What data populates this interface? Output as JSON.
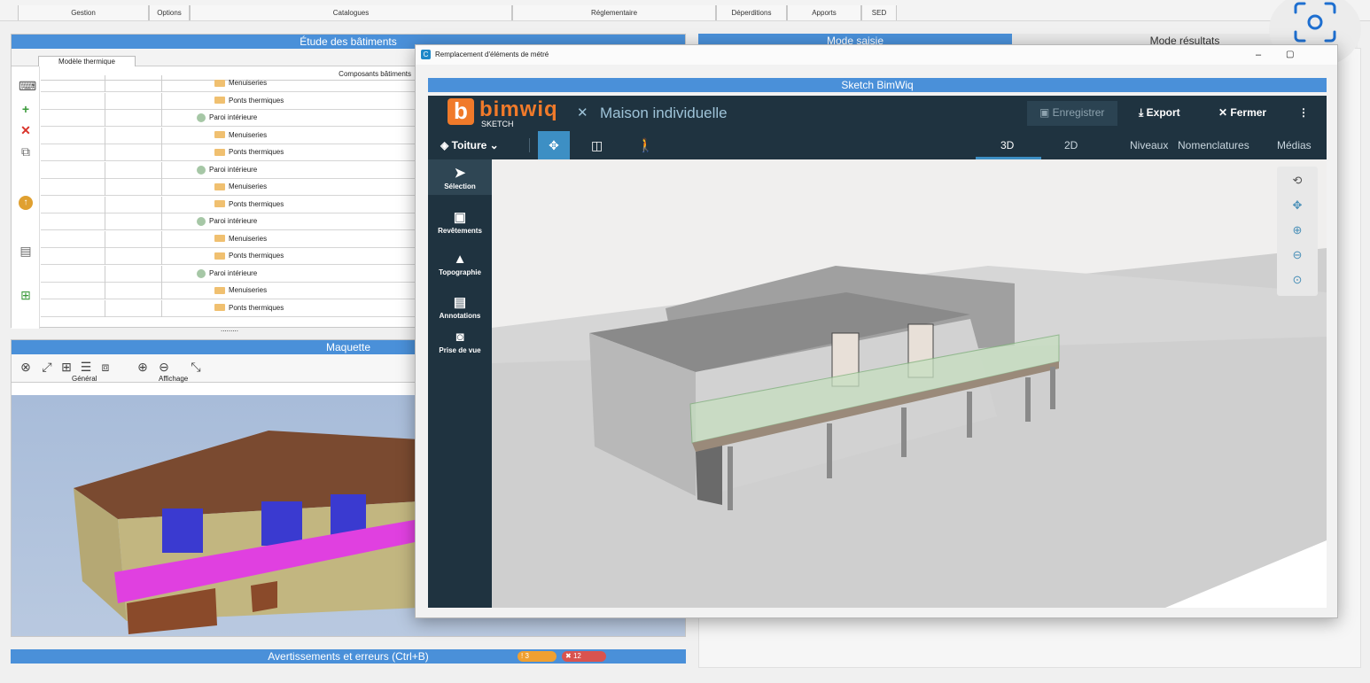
{
  "menu": [
    "Gestion",
    "Options",
    "Catalogues",
    "Réglementaire",
    "Déperditions",
    "Apports",
    "SED"
  ],
  "etude": {
    "title": "Étude des bâtiments",
    "tab": "Modèle thermique",
    "tree_header": "Composants bâtiments",
    "rows": [
      {
        "label": "Menuiseries",
        "kind": "folder"
      },
      {
        "label": "Ponts thermiques",
        "kind": "folder"
      },
      {
        "label": "Paroi intérieure",
        "kind": "wall"
      },
      {
        "label": "Menuiseries",
        "kind": "folder"
      },
      {
        "label": "Ponts thermiques",
        "kind": "folder"
      },
      {
        "label": "Paroi intérieure",
        "kind": "wall"
      },
      {
        "label": "Menuiseries",
        "kind": "folder"
      },
      {
        "label": "Ponts thermiques",
        "kind": "folder"
      },
      {
        "label": "Paroi intérieure",
        "kind": "wall"
      },
      {
        "label": "Menuiseries",
        "kind": "folder"
      },
      {
        "label": "Ponts thermiques",
        "kind": "folder"
      },
      {
        "label": "Paroi intérieure",
        "kind": "wall"
      },
      {
        "label": "Menuiseries",
        "kind": "folder"
      },
      {
        "label": "Ponts thermiques",
        "kind": "folder"
      }
    ],
    "more": "........."
  },
  "maquette": {
    "title": "Maquette",
    "group_general": "Général",
    "group_affichage": "Affichage"
  },
  "warnings": {
    "title": "Avertissements et erreurs (Ctrl+B)",
    "warn_count": "3",
    "error_count": "12",
    "warn_color": "#f0a030",
    "error_color": "#d9534f"
  },
  "right": {
    "mode_saisie": "Mode saisie",
    "mode_resultats": "Mode résultats"
  },
  "dialog": {
    "title": "Remplacement d'éléments de métré",
    "sketch_title": "Sketch BimWiq",
    "app": {
      "logo": "bimwiq",
      "logo_sub": "SKETCH",
      "project": "Maison individuelle",
      "save": "Enregistrer",
      "export": "Export",
      "close": "Fermer",
      "layer": "Toiture",
      "tabs": [
        "3D",
        "2D",
        "Niveaux",
        "Nomenclatures",
        "Médias"
      ],
      "active_tab": "3D",
      "sidebar": [
        "Sélection",
        "Revêtements",
        "Topographie",
        "Annotations",
        "Prise de vue"
      ],
      "accent": "#f07a2a"
    }
  }
}
